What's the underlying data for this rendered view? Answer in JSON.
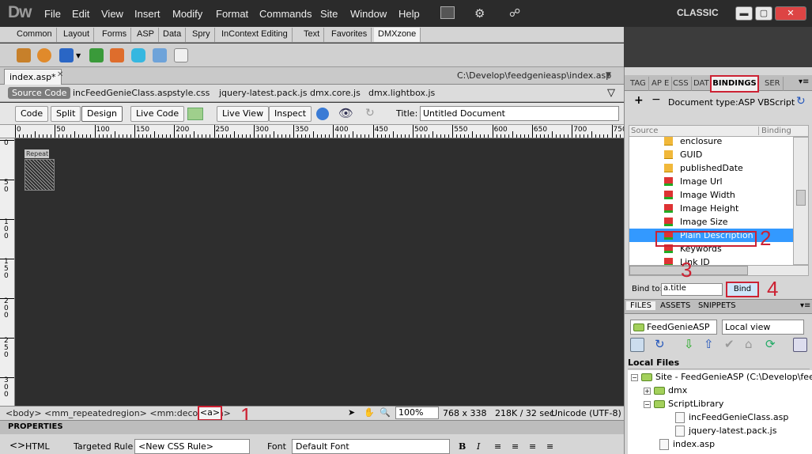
{
  "app": {
    "logo": "Dw",
    "workspace": "CLASSIC"
  },
  "menu": [
    "File",
    "Edit",
    "View",
    "Insert",
    "Modify",
    "Format",
    "Commands",
    "Site",
    "Window",
    "Help"
  ],
  "insert_tabs": [
    "Common",
    "Layout",
    "Forms",
    "ASP",
    "Data",
    "Spry",
    "InContext Editing",
    "Text",
    "Favorites",
    "DMXzone"
  ],
  "insert_active": "DMXzone",
  "doc": {
    "tab": "index.asp*",
    "path": "C:\\Develop\\feedgenieasp\\index.asp",
    "related": [
      "Source Code",
      "incFeedGenieClass.asp",
      "style.css",
      "jquery-latest.pack.js",
      "dmx.core.js",
      "dmx.lightbox.js"
    ]
  },
  "viewbar": {
    "code": "Code",
    "split": "Split",
    "design": "Design",
    "live_code": "Live Code",
    "live_view": "Live View",
    "inspect": "Inspect",
    "title_label": "Title:",
    "title_value": "Untitled Document"
  },
  "ruler": {
    "h": [
      "0",
      "50",
      "100",
      "150",
      "200",
      "250",
      "300",
      "350",
      "400",
      "450",
      "500",
      "550",
      "600",
      "650",
      "700",
      "750"
    ],
    "v": [
      "0",
      "50",
      "100",
      "150",
      "200",
      "250",
      "300"
    ]
  },
  "canvas": {
    "repeat_label": "Repeat"
  },
  "status": {
    "tag_selector": "<body> <mm_repeatedregion> <mm:decoration>",
    "tag_a": "<a>",
    "zoom": "100%",
    "size": "768 x 338",
    "weight": "218K / 32 sec",
    "encoding": "Unicode (UTF-8)"
  },
  "annotations": {
    "n1": "1",
    "n2": "2",
    "n3": "3",
    "n4": "4"
  },
  "properties": {
    "header": "PROPERTIES",
    "html": "HTML",
    "targeted_rule_label": "Targeted Rule",
    "targeted_rule_value": "<New CSS Rule>",
    "font_label": "Font",
    "font_value": "Default Font",
    "bold": "B",
    "italic": "I"
  },
  "panel": {
    "tabs": [
      "TAG",
      "AP E",
      "CSS",
      "DAT",
      "BINDINGS",
      "SER"
    ],
    "doc_type": "Document type:ASP VBScript",
    "plus": "+",
    "minus": "−",
    "source_header": "Source",
    "binding_header": "Binding",
    "items": [
      "enclosure",
      "GUID",
      "publishedDate",
      "Image Url",
      "Image Width",
      "Image Height",
      "Image Size",
      "Plain Description",
      "Keywords",
      "Link ID"
    ],
    "selected_item": "Plain Description",
    "bind_to_label": "Bind to:",
    "bind_to_value": "a.title",
    "bind_button": "Bind"
  },
  "files": {
    "tabs": [
      "FILES",
      "ASSETS",
      "SNIPPETS"
    ],
    "site": "FeedGenieASP",
    "view": "Local view",
    "local_files": "Local Files",
    "tree": [
      "Site - FeedGenieASP (C:\\Develop\\fee...",
      "dmx",
      "ScriptLibrary",
      "incFeedGenieClass.asp",
      "jquery-latest.pack.js",
      "index.asp"
    ]
  }
}
